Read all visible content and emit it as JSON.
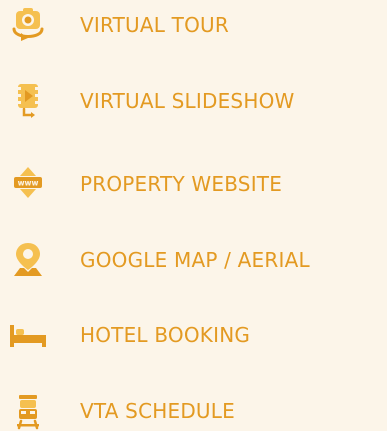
{
  "theme": {
    "accent": "#e39a22",
    "accent_light": "#f5c050",
    "background": "#fcf5e9"
  },
  "menu": {
    "items": [
      {
        "icon": "camera-rotate-icon",
        "label": "VIRTUAL TOUR"
      },
      {
        "icon": "video-slideshow-icon",
        "label": "VIRTUAL SLIDESHOW"
      },
      {
        "icon": "www-globe-icon",
        "label": "PROPERTY WEBSITE"
      },
      {
        "icon": "map-pin-icon",
        "label": "GOOGLE MAP / AERIAL"
      },
      {
        "icon": "bed-icon",
        "label": "HOTEL BOOKING"
      },
      {
        "icon": "train-icon",
        "label": "VTA SCHEDULE"
      }
    ]
  }
}
